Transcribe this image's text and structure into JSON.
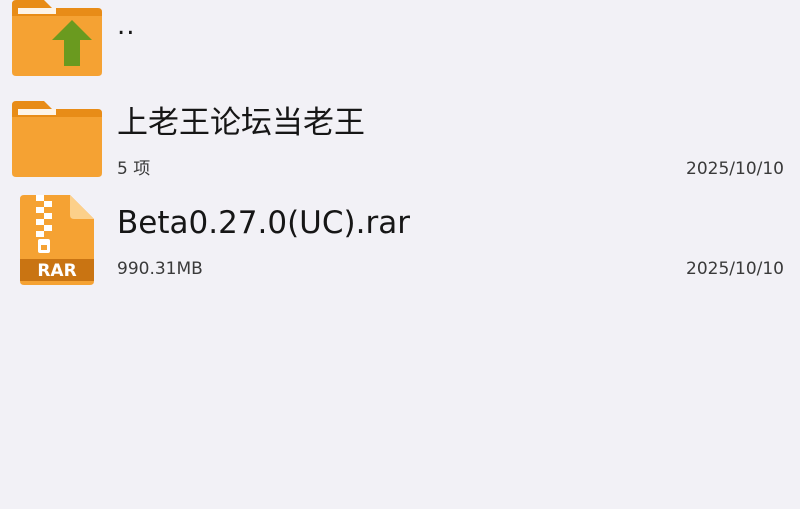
{
  "colors": {
    "background": "#f2f1f6",
    "folder": "#f5a233",
    "folder_tab": "#e88c17",
    "up_arrow": "#6a9a1f",
    "rar_badge": "#c97412"
  },
  "files": [
    {
      "type": "parent",
      "icon": "folder-up-icon",
      "name": ".."
    },
    {
      "type": "folder",
      "icon": "folder-icon",
      "name": "上老王论坛当老王",
      "meta": "5 项",
      "date": "2025/10/10"
    },
    {
      "type": "archive",
      "icon": "rar-file-icon",
      "badge": "RAR",
      "name": "Beta0.27.0(UC).rar",
      "meta": "990.31MB",
      "date": "2025/10/10"
    }
  ]
}
